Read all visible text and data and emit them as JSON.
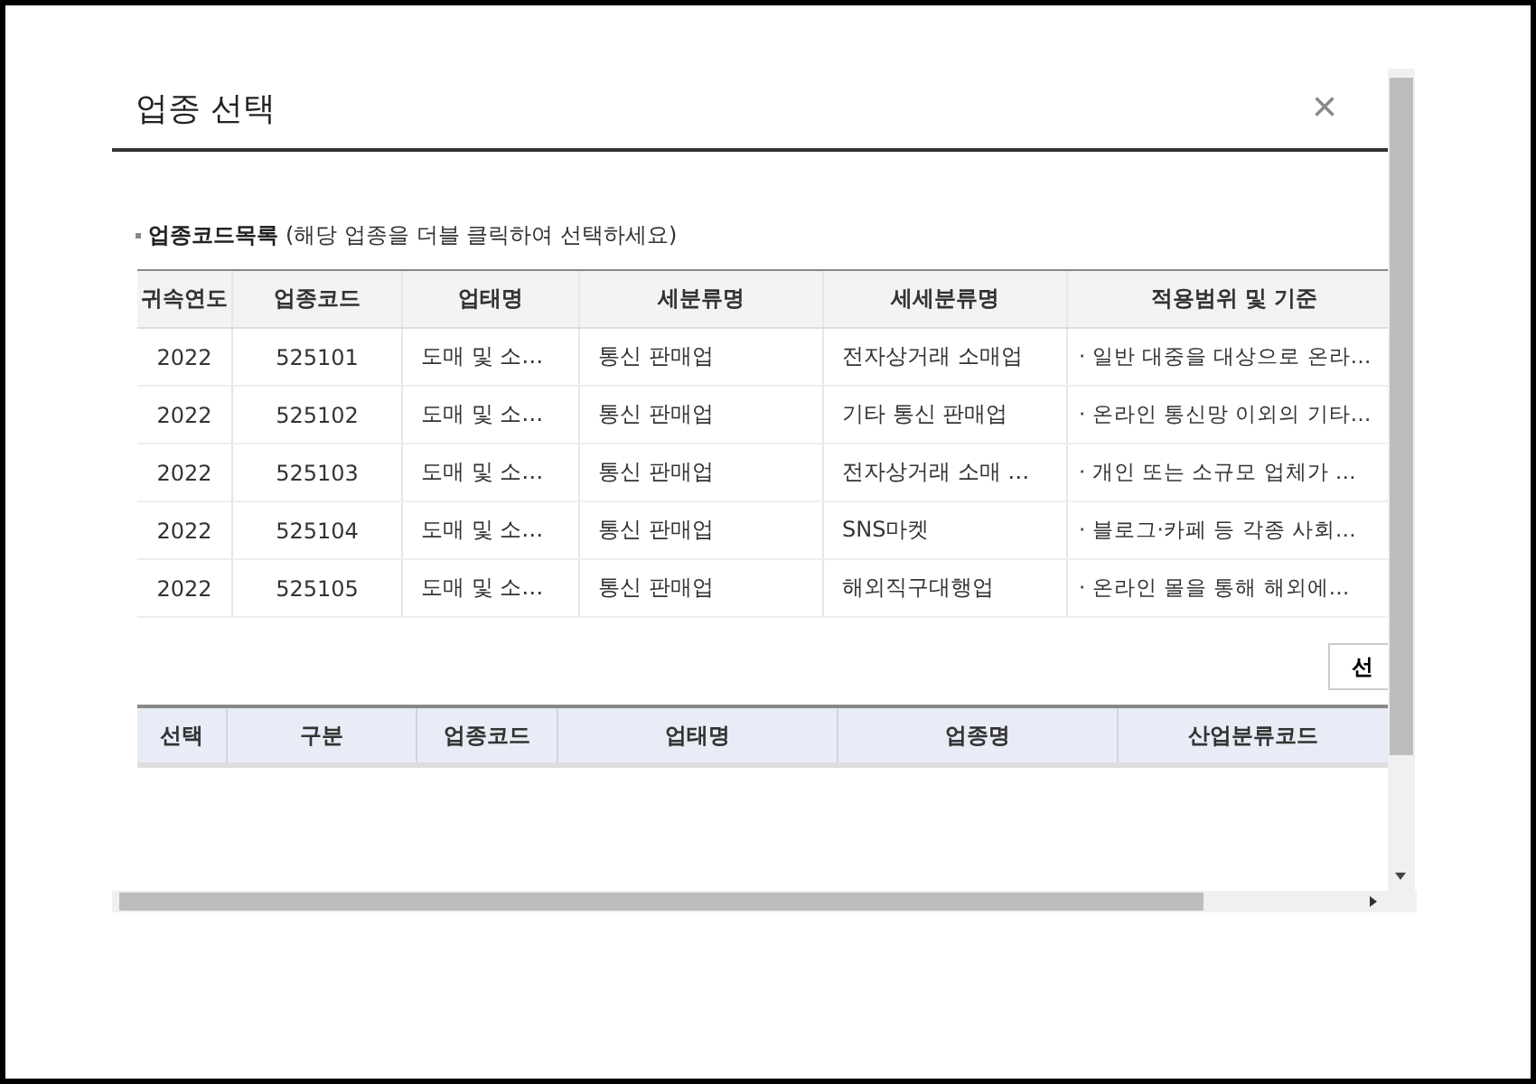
{
  "dialog": {
    "title": "업종 선택",
    "close": "×"
  },
  "list_section": {
    "label": "업종코드목록",
    "hint": "(해당 업종을 더블 클릭하여 선택하세요)"
  },
  "codes_table": {
    "columns": [
      "귀속연도",
      "업종코드",
      "업태명",
      "세분류명",
      "세세분류명",
      "적용범위 및 기준"
    ],
    "rows": [
      [
        "2022",
        "525101",
        "도매 및 소…",
        "통신 판매업",
        "전자상거래 소매업",
        "· 일반 대중을 대상으로 온라…"
      ],
      [
        "2022",
        "525102",
        "도매 및 소…",
        "통신 판매업",
        "기타 통신 판매업",
        "· 온라인 통신망 이외의 기타…"
      ],
      [
        "2022",
        "525103",
        "도매 및 소…",
        "통신 판매업",
        "전자상거래 소매 …",
        "· 개인 또는 소규모 업체가 …"
      ],
      [
        "2022",
        "525104",
        "도매 및 소…",
        "통신 판매업",
        "SNS마켓",
        "· 블로그·카페 등 각종 사회…"
      ],
      [
        "2022",
        "525105",
        "도매 및 소…",
        "통신 판매업",
        "해외직구대행업",
        "·  온라인 몰을 통해 해외에…"
      ]
    ]
  },
  "select_button": "선",
  "selected_table": {
    "columns": [
      "선택",
      "구분",
      "업종코드",
      "업태명",
      "업종명",
      "산업분류코드"
    ]
  }
}
